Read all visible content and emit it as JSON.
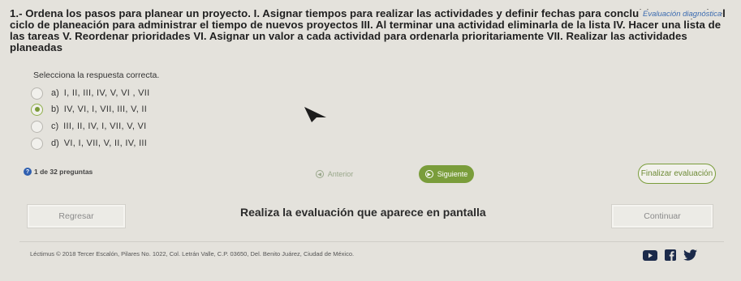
{
  "question": {
    "text": "1.- Ordena los pasos para planear un proyecto. I. Asignar tiempos para realizar las actividades y definir fechas para concluirlas II. Repetir el ciclo de planeación para administrar el tiempo de nuevos proyectos III. Al terminar una actividad eliminarla de la lista IV. Hacer una lista de las tareas V. Reordenar prioridades VI. Asignar un valor a cada actividad para ordenarla prioritariamente VII. Realizar las actividades planeadas",
    "badge": "Evaluación diagnóstica"
  },
  "instruction": "Selecciona la respuesta correcta.",
  "options": [
    {
      "letter": "a)",
      "text": "I, II, III, IV, V, VI , VII",
      "selected": false
    },
    {
      "letter": "b)",
      "text": "IV, VI, I, VII, III, V, II",
      "selected": true
    },
    {
      "letter": "c)",
      "text": "III, II, IV, I, VII, V, VI",
      "selected": false
    },
    {
      "letter": "d)",
      "text": "VI, I, VII, V, II, IV, III",
      "selected": false
    }
  ],
  "progress": {
    "text": "1 de 32 preguntas",
    "icon": "info-icon"
  },
  "nav": {
    "prev_label": "Anterior",
    "next_label": "Siguiente",
    "finish_label": "Finalizar evaluación"
  },
  "footer_nav": {
    "back_label": "Regresar",
    "message": "Realiza la evaluación que aparece en pantalla",
    "continue_label": "Continuar"
  },
  "footer": {
    "copyright": "Léctimus © 2018 Tercer Escalón, Pilares No. 1022, Col. Letrán Valle, C.P. 03650, Del. Benito Juárez, Ciudad de México.",
    "social_icons": [
      "youtube-icon",
      "facebook-icon",
      "twitter-icon"
    ]
  },
  "colors": {
    "accent": "#7a9d3b",
    "badge": "#3b6bb0",
    "background": "#e4e2dc"
  }
}
